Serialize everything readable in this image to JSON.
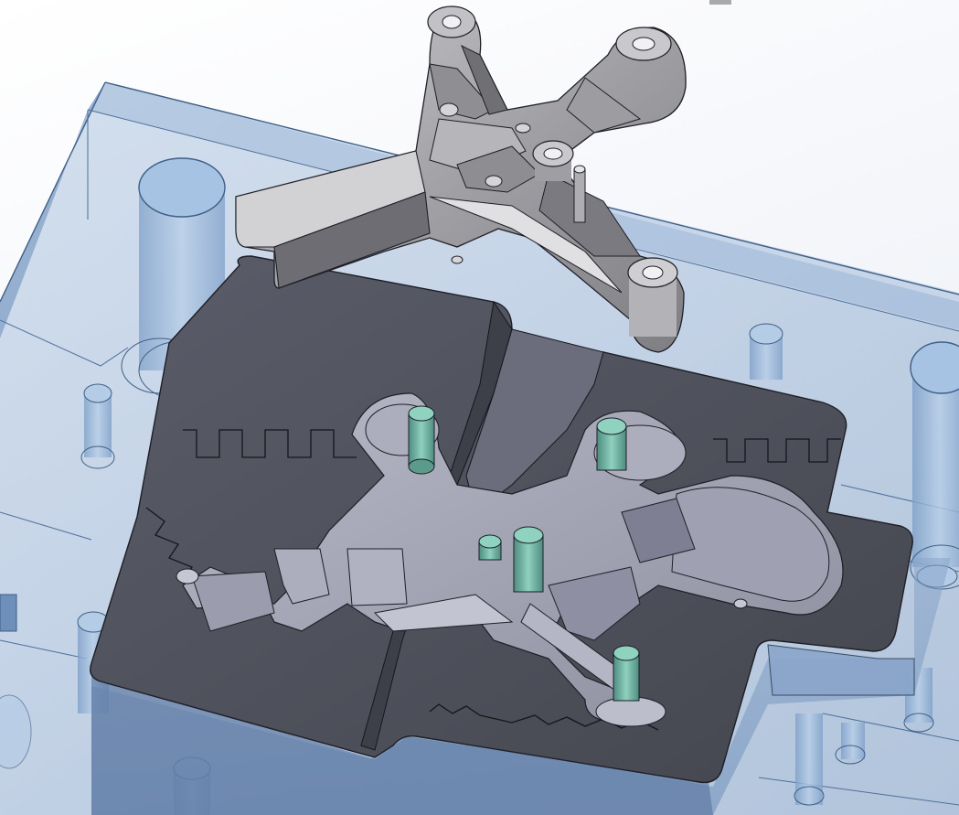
{
  "viewport": {
    "background": "#ffffff",
    "render_mode": "shaded-with-edges",
    "view": "isometric"
  },
  "scene": {
    "description_names": [
      "mold-base-transparent",
      "core-insert",
      "cast-part",
      "ejector-pins"
    ],
    "colors": {
      "mold_base": "#8fb0d6",
      "mold_base_edge": "#3e5f86",
      "core_insert": "#4d4f5b",
      "core_cavity": "#a3a4b4",
      "cast_part": "#a4a4a8",
      "ejector_pin": "#6fb3a3",
      "edge": "#1e1f26"
    }
  }
}
